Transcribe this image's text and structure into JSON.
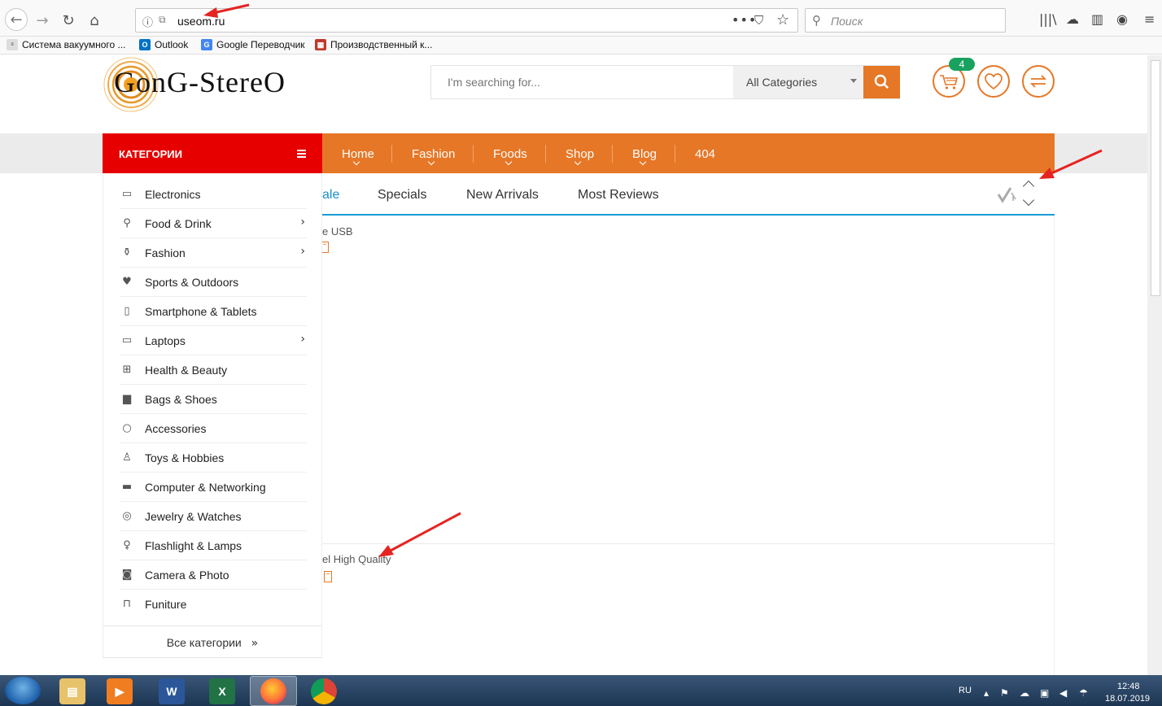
{
  "browser": {
    "url": "useom.ru",
    "search_placeholder": "Поиск",
    "bookmarks": [
      {
        "label": "Система вакуумного ..."
      },
      {
        "label": "Outlook"
      },
      {
        "label": "Google Переводчик"
      },
      {
        "label": "Производственный к..."
      }
    ]
  },
  "site": {
    "logo_text": "GonG-StereO",
    "search_placeholder": "I'm searching for...",
    "category_select": "All Categories",
    "cart_count": "4",
    "colors": {
      "accent": "#e67726",
      "category_header": "#e60000",
      "tab_active": "#1a8fd0",
      "badge": "#19a25f"
    }
  },
  "nav": {
    "category_header": "КАТЕГОРИИ",
    "items": [
      {
        "label": "Home"
      },
      {
        "label": "Fashion"
      },
      {
        "label": "Foods"
      },
      {
        "label": "Shop"
      },
      {
        "label": "Blog"
      },
      {
        "label": "404"
      }
    ]
  },
  "categories": {
    "items": [
      {
        "label": "Electronics",
        "icon": "monitor-play-icon"
      },
      {
        "label": "Food & Drink",
        "icon": "bicycle-icon"
      },
      {
        "label": "Fashion",
        "icon": "dress-icon"
      },
      {
        "label": "Sports & Outdoors",
        "icon": "heartbeat-icon"
      },
      {
        "label": "Smartphone & Tablets",
        "icon": "phone-icon"
      },
      {
        "label": "Laptops",
        "icon": "laptop-icon"
      },
      {
        "label": "Health & Beauty",
        "icon": "plus-square-icon"
      },
      {
        "label": "Bags & Shoes",
        "icon": "bag-icon"
      },
      {
        "label": "Accessories",
        "icon": "ring-icon"
      },
      {
        "label": "Toys & Hobbies",
        "icon": "penguin-icon"
      },
      {
        "label": "Computer & Networking",
        "icon": "desktop-icon"
      },
      {
        "label": "Jewelry & Watches",
        "icon": "diamond-ring-icon"
      },
      {
        "label": "Flashlight & Lamps",
        "icon": "bulb-icon"
      },
      {
        "label": "Camera & Photo",
        "icon": "camera-icon"
      },
      {
        "label": "Funiture",
        "icon": "sofa-icon"
      }
    ],
    "all_label": "Все категории"
  },
  "tabs": {
    "items": [
      {
        "label": "ale"
      },
      {
        "label": "Specials"
      },
      {
        "label": "New Arrivals"
      },
      {
        "label": "Most Reviews"
      }
    ]
  },
  "products": {
    "first_fragment": "e USB",
    "second_fragment": "el High Quality"
  },
  "taskbar": {
    "lang": "RU",
    "time": "12:48",
    "date": "18.07.2019"
  }
}
